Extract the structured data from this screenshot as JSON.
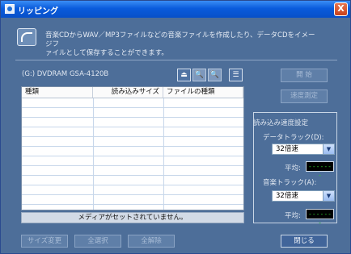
{
  "window": {
    "title": "リッピング",
    "close_label": "X"
  },
  "header": {
    "description_line1": "音楽CDからWAV／MP3ファイルなどの音楽ファイルを作成したり、データCDをイメージフ",
    "description_line2": "ァイルとして保存することができます。"
  },
  "drive": {
    "label": "(G:) DVDRAM GSA-4120B"
  },
  "toolbar": {
    "eject": "⏏",
    "search1": "🔍",
    "search2": "🔍",
    "list": "☰"
  },
  "side_buttons": {
    "start": "開 始",
    "speed_measure": "速度測定"
  },
  "table": {
    "columns": [
      "種類",
      "読み込みサイズ",
      "ファイルの種類"
    ]
  },
  "status": {
    "message": "メディアがセットされていません。"
  },
  "speed": {
    "title": "読み込み速度設定",
    "data_track_label": "データトラック(D):",
    "data_track_value": "32倍速",
    "avg_label_1": "平均:",
    "avg_value_1": "-------",
    "audio_track_label": "音楽トラック(A):",
    "audio_track_value": "32倍速",
    "avg_label_2": "平均:",
    "avg_value_2": "-------"
  },
  "bottom_buttons": {
    "size_change": "サイズ変更",
    "select_all": "全選択",
    "deselect_all": "全解除",
    "close": "閉じる"
  },
  "colors": {
    "background": "#4d6e99",
    "titlebar": "#0a5bdc",
    "close": "#c8421c",
    "meter": "#2bd22b"
  }
}
